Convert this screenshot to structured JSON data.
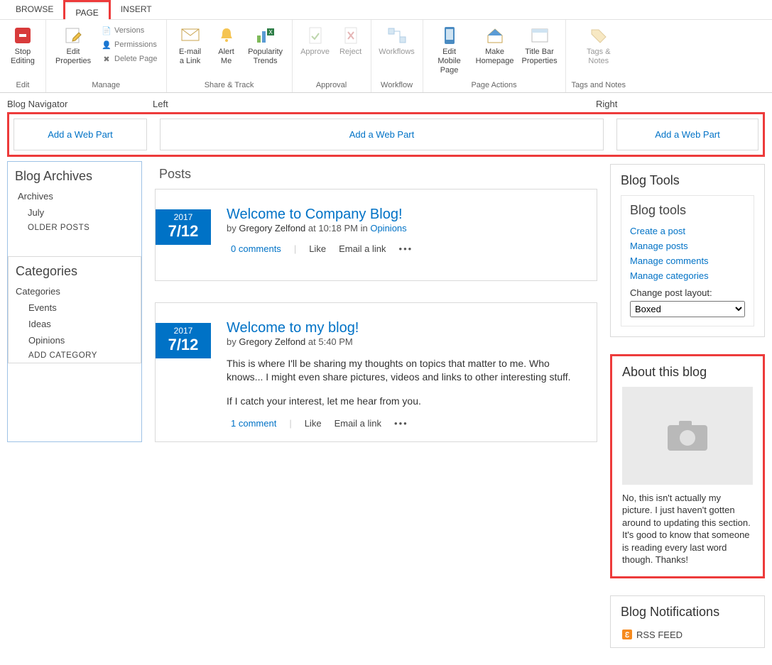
{
  "ribbon": {
    "tabs": {
      "browse": "BROWSE",
      "page": "PAGE",
      "insert": "INSERT"
    },
    "groups": {
      "edit": {
        "label": "Edit",
        "stop_editing": "Stop Editing"
      },
      "manage": {
        "label": "Manage",
        "edit_properties": "Edit Properties",
        "versions": "Versions",
        "permissions": "Permissions",
        "delete_page": "Delete Page"
      },
      "share_track": {
        "label": "Share & Track",
        "email_link": "E-mail a Link",
        "alert_me": "Alert Me",
        "popularity": "Popularity Trends"
      },
      "approval": {
        "label": "Approval",
        "approve": "Approve",
        "reject": "Reject"
      },
      "workflow": {
        "label": "Workflow",
        "workflows": "Workflows"
      },
      "page_actions": {
        "label": "Page Actions",
        "edit_mobile": "Edit Mobile Page",
        "make_homepage": "Make Homepage",
        "title_bar": "Title Bar Properties"
      },
      "tags_notes": {
        "label": "Tags and Notes",
        "tags_notes": "Tags & Notes"
      }
    }
  },
  "zones": {
    "blog_nav": "Blog Navigator",
    "left": "Left",
    "right": "Right"
  },
  "add_web_part": "Add a Web Part",
  "nav": {
    "archives_h": "Blog Archives",
    "archives_label": "Archives",
    "july": "July",
    "older": "OLDER POSTS",
    "categories_h": "Categories",
    "categories_label": "Categories",
    "cats": [
      "Events",
      "Ideas",
      "Opinions"
    ],
    "add_cat": "ADD CATEGORY"
  },
  "posts_h": "Posts",
  "posts": [
    {
      "year": "2017",
      "date": "7/12",
      "title": "Welcome to Company Blog!",
      "by": "by ",
      "author": "Gregory Zelfond",
      "at": " at 10:18 PM in ",
      "category": "Opinions",
      "body": "",
      "comments": "0 comments",
      "like": "Like",
      "email": "Email a link"
    },
    {
      "year": "2017",
      "date": "7/12",
      "title": "Welcome to my blog!",
      "by": "by ",
      "author": "Gregory Zelfond",
      "at": " at 5:40 PM",
      "category": "",
      "body1": "This is where I'll be sharing my thoughts on topics that matter to me. Who knows... I might even share pictures, videos and links to other interesting stuff.",
      "body2": "If I catch your interest, let me hear from you.",
      "comments": "1 comment",
      "like": "Like",
      "email": "Email a link"
    }
  ],
  "right": {
    "blog_tools_h": "Blog Tools",
    "blog_tools_inner_h": "Blog tools",
    "tools": [
      "Create a post",
      "Manage posts",
      "Manage comments",
      "Manage categories"
    ],
    "layout_label": "Change post layout:",
    "layout_value": "Boxed",
    "about_h": "About this blog",
    "about_text": "No, this isn't actually my picture. I just haven't gotten around to updating this section. It's good to know that someone is reading every last word though. Thanks!",
    "notif_h": "Blog Notifications",
    "rss": "RSS FEED"
  }
}
